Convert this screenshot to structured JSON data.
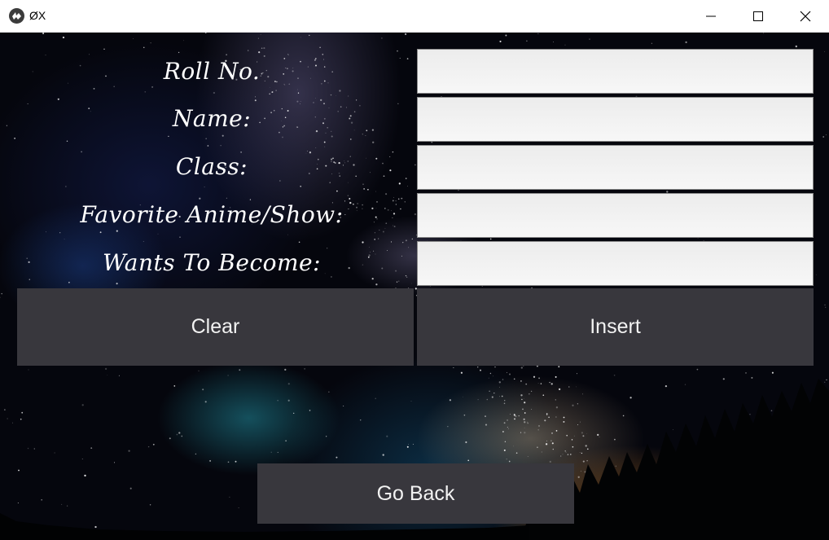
{
  "window": {
    "title": "ØX",
    "app_icon": "kivy-logo-icon",
    "controls": [
      "minimize-icon",
      "maximize-icon",
      "close-icon"
    ]
  },
  "form": {
    "labels": {
      "roll_no": "Roll No.",
      "name": "Name:",
      "class": "Class:",
      "favorite": "Favorite Anime/Show:",
      "wants_to_become": "Wants To Become:"
    },
    "values": {
      "roll_no": "",
      "name": "",
      "class": "",
      "favorite": "",
      "wants_to_become": ""
    }
  },
  "buttons": {
    "clear": "Clear",
    "insert": "Insert",
    "go_back": "Go Back"
  },
  "colors": {
    "button_bg": "#38373d",
    "button_text": "#f2f2f2",
    "field_bg": "#f0f0f0",
    "label_text": "#ffffff"
  }
}
